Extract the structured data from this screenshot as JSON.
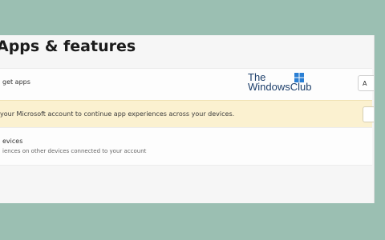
{
  "page": {
    "title": "Apps & features",
    "choose_label": "Choose where to get apps",
    "choose_visible": "get apps",
    "choose_dropdown_peek": "A",
    "banner_text": "your Microsoft account to continue app experiences across your devices.",
    "share_title": "evices",
    "share_subtitle": "iences on other devices connected to your account"
  },
  "watermark": {
    "line1": "The",
    "line2": "WindowsClub"
  },
  "colors": {
    "background": "#9bbfb2",
    "panel": "#f6f6f6",
    "banner": "#fbf1d0"
  }
}
